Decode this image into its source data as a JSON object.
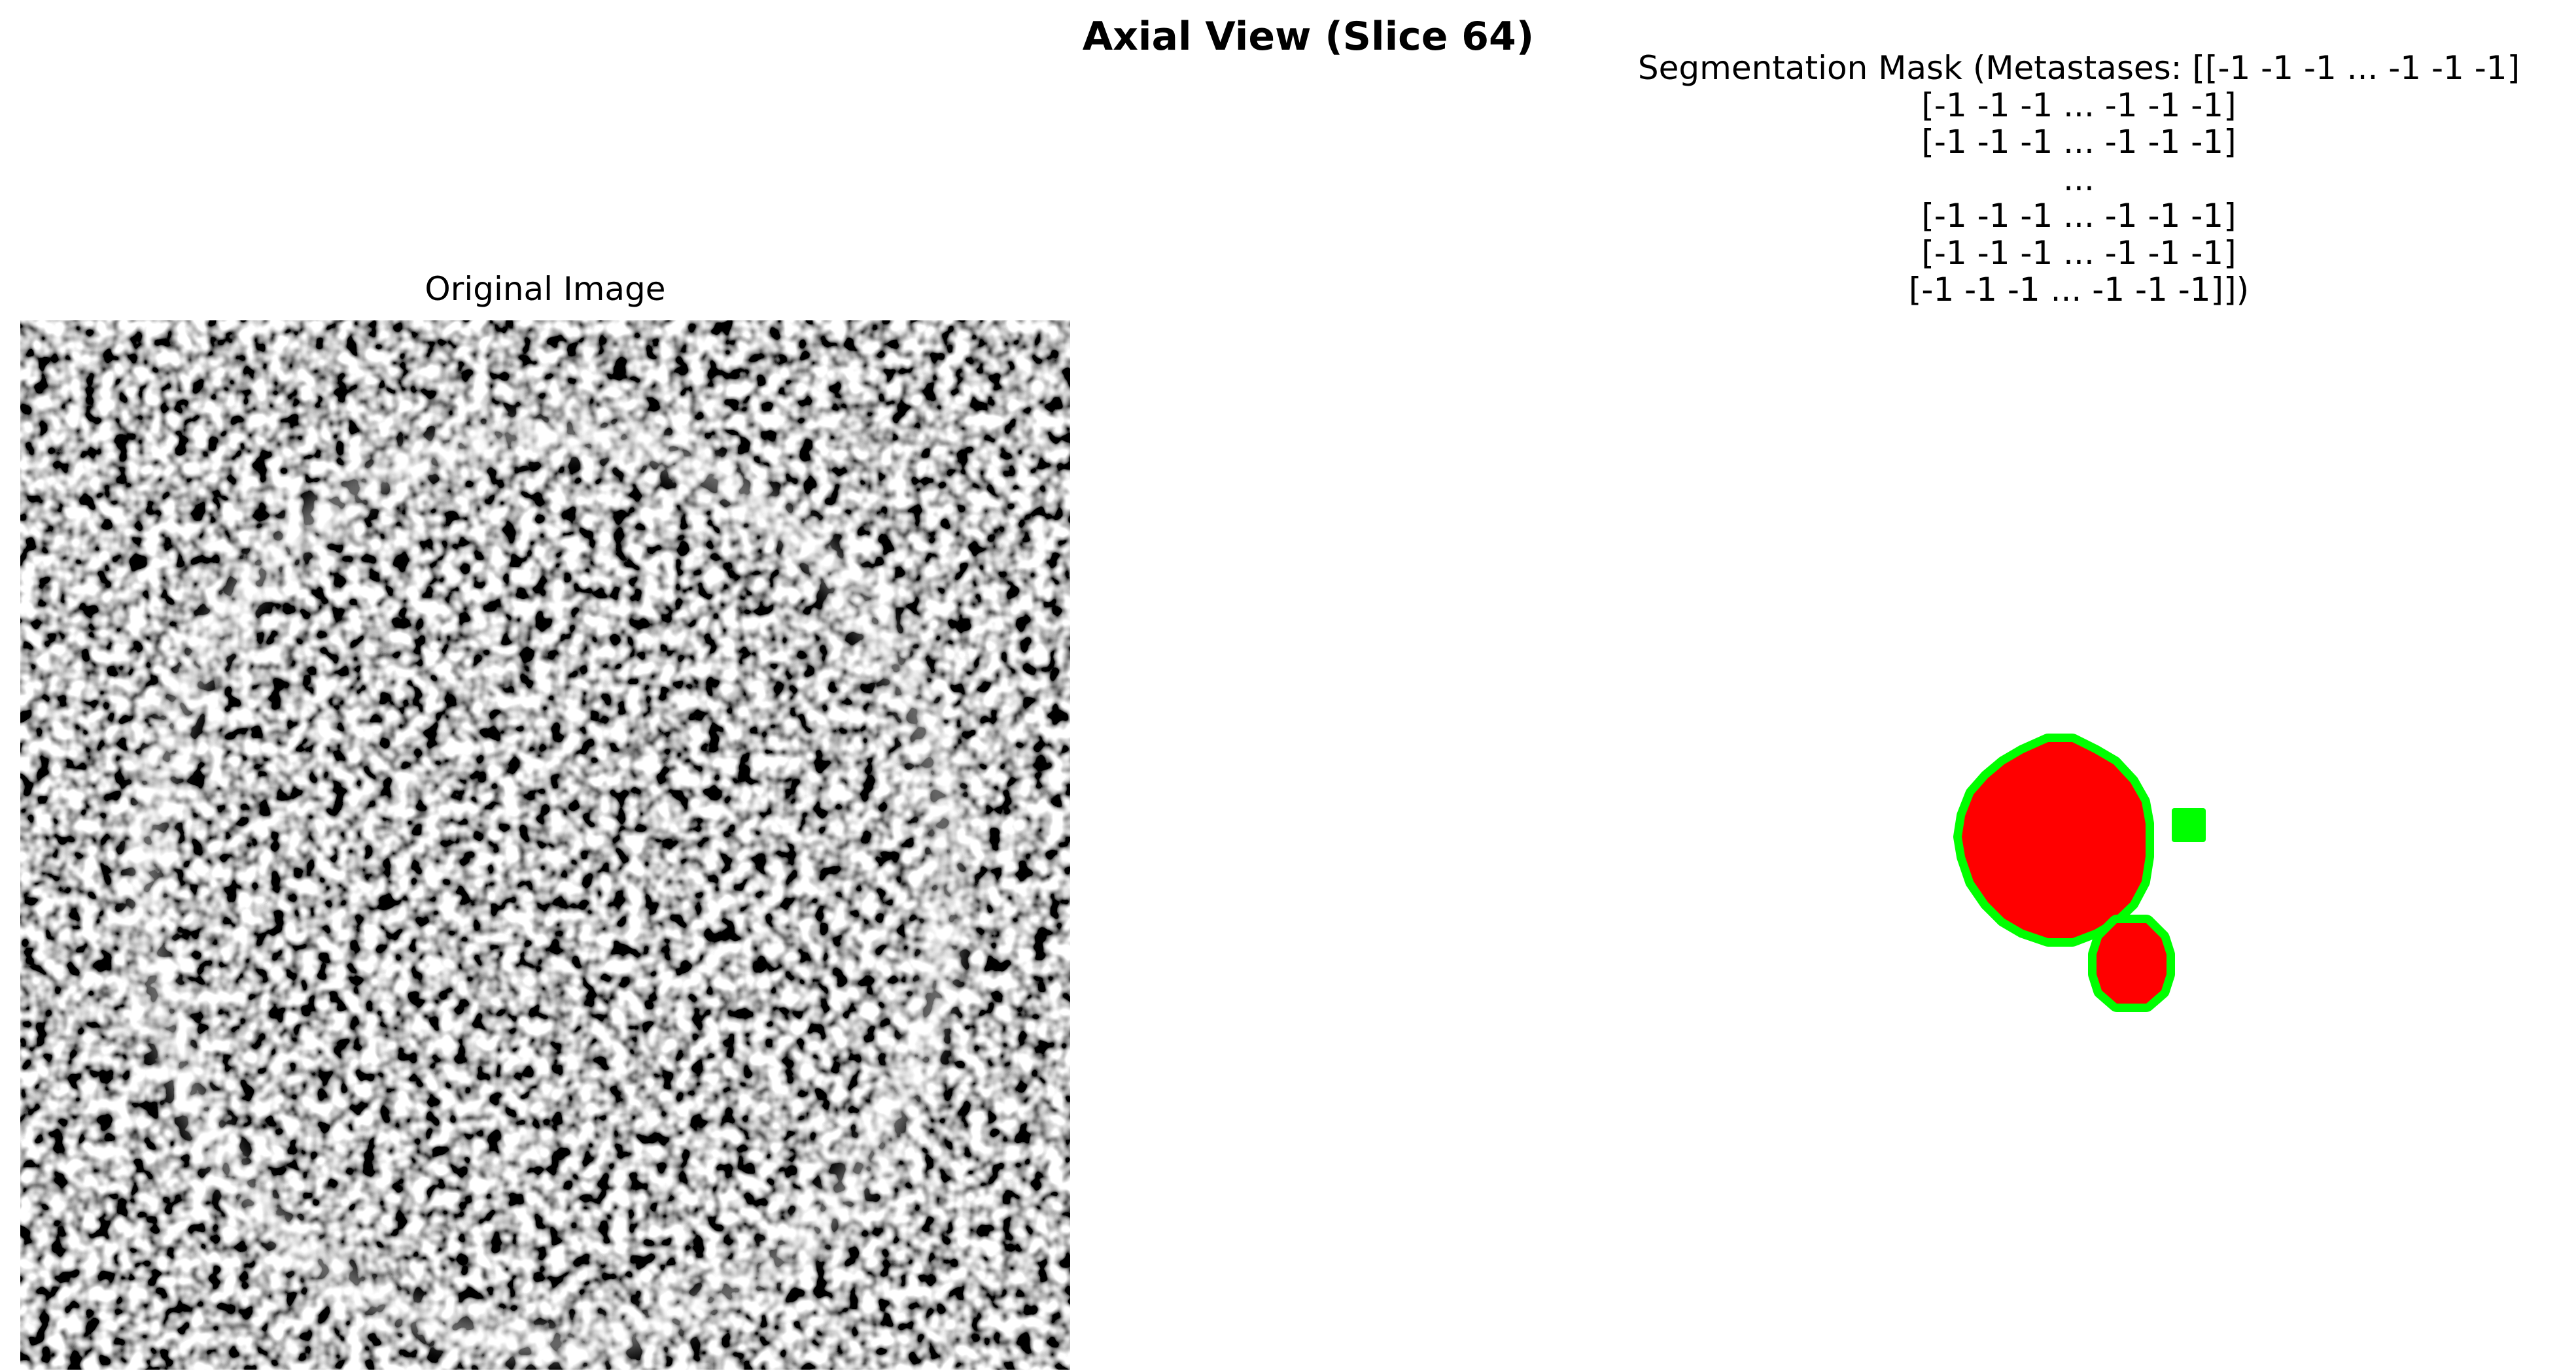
{
  "figure": {
    "suptitle": "Axial View (Slice 64)"
  },
  "left_panel": {
    "title": "Original Image",
    "image": "grayscale noisy axial slice with faint circular ring"
  },
  "right_panel": {
    "title_lines": [
      "Segmentation Mask (Metastases: [[-1 -1 -1 ... -1 -1 -1]",
      "[-1 -1 -1 ... -1 -1 -1]",
      "[-1 -1 -1 ... -1 -1 -1]",
      "...",
      "[-1 -1 -1 ... -1 -1 -1]",
      "[-1 -1 -1 ... -1 -1 -1]",
      "[-1 -1 -1 ... -1 -1 -1]])"
    ],
    "colors": {
      "lesion_fill": "#ff0000",
      "lesion_outline": "#00ff00"
    }
  }
}
